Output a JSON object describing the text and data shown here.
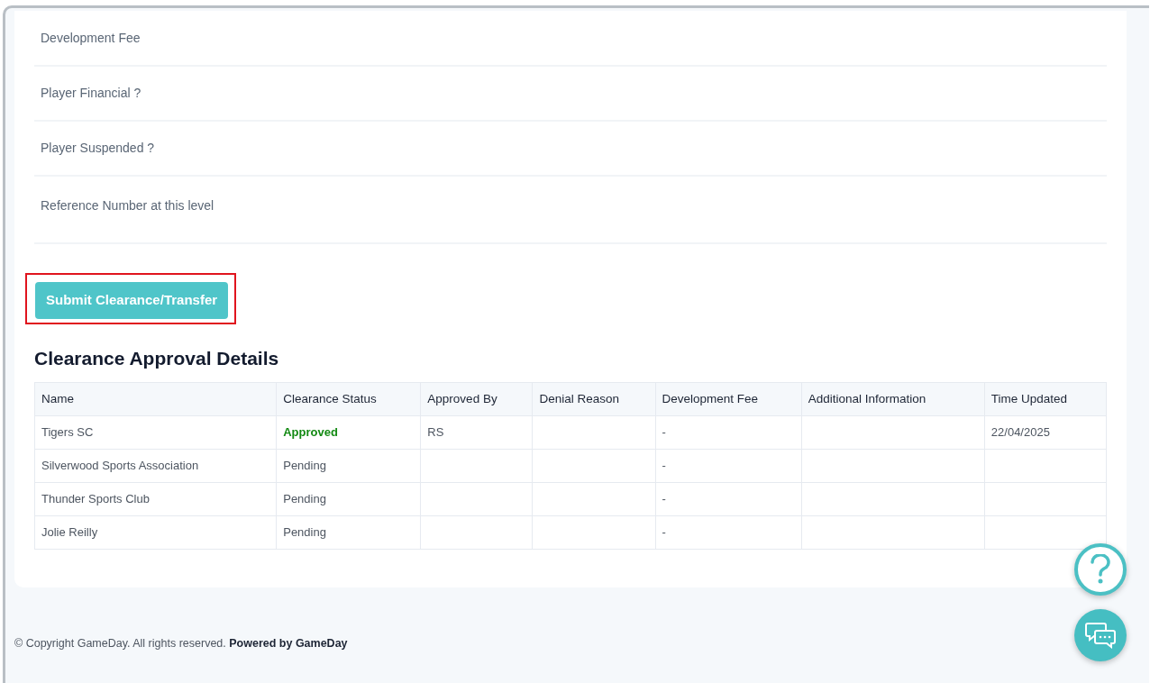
{
  "form_fields": [
    {
      "label": "Development Fee"
    },
    {
      "label": "Player Financial ?"
    },
    {
      "label": "Player Suspended ?"
    },
    {
      "label": "Reference Number at this level"
    }
  ],
  "submit_button": {
    "label": "Submit Clearance/Transfer",
    "highlighted": true
  },
  "approvals": {
    "title": "Clearance Approval Details",
    "columns": [
      "Name",
      "Clearance Status",
      "Approved By",
      "Denial Reason",
      "Development Fee",
      "Additional Information",
      "Time Updated"
    ],
    "rows": [
      {
        "approved": true,
        "cells": [
          "Tigers SC",
          "Approved",
          "RS",
          "",
          "-",
          "",
          "22/04/2025"
        ]
      },
      {
        "approved": false,
        "cells": [
          "Silverwood Sports Association",
          "Pending",
          "",
          "",
          "-",
          "",
          ""
        ]
      },
      {
        "approved": false,
        "cells": [
          "Thunder Sports Club",
          "Pending",
          "",
          "",
          "-",
          "",
          ""
        ]
      },
      {
        "approved": false,
        "cells": [
          "Jolie Reilly",
          "Pending",
          "",
          "",
          "-",
          "",
          ""
        ]
      }
    ]
  },
  "footer": {
    "symbol": "©",
    "text": "Copyright GameDay. All rights reserved.",
    "link": "Powered by GameDay"
  }
}
